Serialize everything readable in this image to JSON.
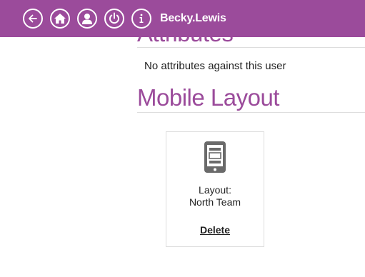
{
  "header": {
    "username": "Becky.Lewis",
    "icons": [
      "back-icon",
      "home-icon",
      "user-icon",
      "power-icon",
      "info-icon"
    ]
  },
  "attributes": {
    "title": "Attributes",
    "empty_text": "No attributes against this user"
  },
  "mobile_layout": {
    "title": "Mobile Layout",
    "card": {
      "icon": "mobile-device-icon",
      "label_line1": "Layout:",
      "label_line2": "North Team",
      "delete_label": "Delete"
    }
  },
  "colors": {
    "accent": "#9b4b9b",
    "header_bg": "#9b4b9b"
  }
}
